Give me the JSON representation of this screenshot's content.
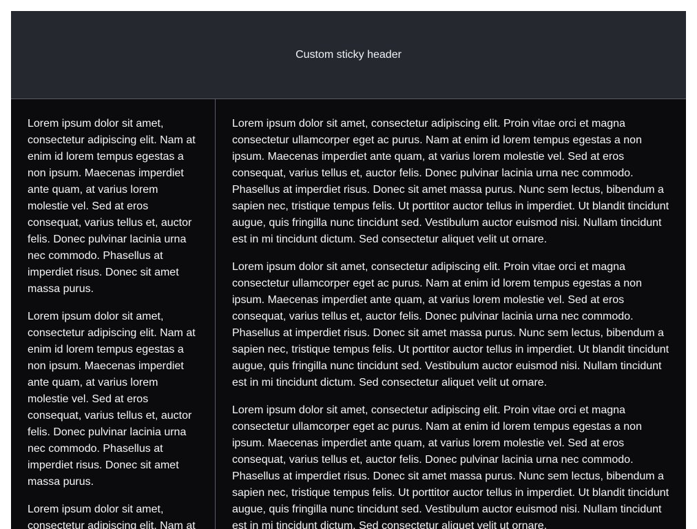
{
  "header": {
    "title": "Custom sticky header"
  },
  "left_column": {
    "paragraphs": [
      "Lorem ipsum dolor sit amet, consectetur adipiscing elit. Nam at enim id lorem tempus egestas a non ipsum. Maecenas imperdiet ante quam, at varius lorem molestie vel. Sed at eros consequat, varius tellus et, auctor felis. Donec pulvinar lacinia urna nec commodo. Phasellus at imperdiet risus. Donec sit amet massa purus.",
      "Lorem ipsum dolor sit amet, consectetur adipiscing elit. Nam at enim id lorem tempus egestas a non ipsum. Maecenas imperdiet ante quam, at varius lorem molestie vel. Sed at eros consequat, varius tellus et, auctor felis. Donec pulvinar lacinia urna nec commodo. Phasellus at imperdiet risus. Donec sit amet massa purus.",
      "Lorem ipsum dolor sit amet, consectetur adipiscing elit. Nam at"
    ]
  },
  "right_column": {
    "paragraphs": [
      "Lorem ipsum dolor sit amet, consectetur adipiscing elit. Proin vitae orci et magna consectetur ullamcorper eget ac purus. Nam at enim id lorem tempus egestas a non ipsum. Maecenas imperdiet ante quam, at varius lorem molestie vel. Sed at eros consequat, varius tellus et, auctor felis. Donec pulvinar lacinia urna nec commodo. Phasellus at imperdiet risus. Donec sit amet massa purus. Nunc sem lectus, bibendum a sapien nec, tristique tempus felis. Ut porttitor auctor tellus in imperdiet. Ut blandit tincidunt augue, quis fringilla nunc tincidunt sed. Vestibulum auctor euismod nisi. Nullam tincidunt est in mi tincidunt dictum. Sed consectetur aliquet velit ut ornare.",
      "Lorem ipsum dolor sit amet, consectetur adipiscing elit. Proin vitae orci et magna consectetur ullamcorper eget ac purus. Nam at enim id lorem tempus egestas a non ipsum. Maecenas imperdiet ante quam, at varius lorem molestie vel. Sed at eros consequat, varius tellus et, auctor felis. Donec pulvinar lacinia urna nec commodo. Phasellus at imperdiet risus. Donec sit amet massa purus. Nunc sem lectus, bibendum a sapien nec, tristique tempus felis. Ut porttitor auctor tellus in imperdiet. Ut blandit tincidunt augue, quis fringilla nunc tincidunt sed. Vestibulum auctor euismod nisi. Nullam tincidunt est in mi tincidunt dictum. Sed consectetur aliquet velit ut ornare.",
      "Lorem ipsum dolor sit amet, consectetur adipiscing elit. Proin vitae orci et magna consectetur ullamcorper eget ac purus. Nam at enim id lorem tempus egestas a non ipsum. Maecenas imperdiet ante quam, at varius lorem molestie vel. Sed at eros consequat, varius tellus et, auctor felis. Donec pulvinar lacinia urna nec commodo. Phasellus at imperdiet risus. Donec sit amet massa purus. Nunc sem lectus, bibendum a sapien nec, tristique tempus felis. Ut porttitor auctor tellus in imperdiet. Ut blandit tincidunt augue, quis fringilla nunc tincidunt sed. Vestibulum auctor euismod nisi. Nullam tincidunt est in mi tincidunt dictum. Sed consectetur aliquet velit ut ornare."
    ]
  },
  "colors": {
    "page_background": "#ffffff",
    "content_background": "#0b0b0e",
    "header_background": "#262830",
    "divider": "#5b5d66",
    "text": "#f5f5f7"
  }
}
